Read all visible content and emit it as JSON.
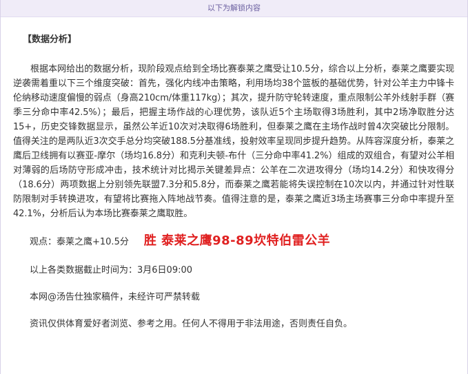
{
  "unlock_bar": {
    "text": "以下为解锁内容"
  },
  "article": {
    "section_title": "【数据分析】",
    "paragraph": "根据本网给出的数据分析，现阶段观点给到全场比赛泰莱之鹰受让10.5分，综合以上分析，泰莱之鹰要实现逆袭需着重以下三个维度突破：首先，强化内线冲击策略，利用场均38个篮板的基础优势，针对公羊主力中锋卡伦纳移动速度偏慢的弱点（身高210cm/体重117kg）；其次，提升防守轮转速度，重点限制公羊外线射手群（赛季三分命中率42.5%）；最后，把握主场作战的心理优势，该队近5个主场取得3场胜利，其中2场净取胜分达15+，历史交锋数据显示，虽然公羊近10次对决取得6场胜利，但泰莱之鹰在主场作战时曾4次突破比分限制。值得关注的是两队近3次交手总分均突破188.5分基准线，投射效率呈现同步提升趋势。从阵容深度分析，泰莱之鹰后卫线拥有以赛亚-摩尔（场均16.8分）和克利夫顿-布什（三分命中率41.2%）组成的双组合，有望对公羊相对薄弱的后场防守形成冲击，技术统计对比揭示关键差异点：公羊在二次进攻得分（场均14.2分）和快攻得分（18.6分）两项数据上分别领先联盟7.3分和5.8分，而泰莱之鹰若能将失误控制在10次以内，并通过针对性联防限制对手转换进攻，有望将比赛拖入阵地战节奏。值得注意的是，泰莱之鹰近3场主场赛事三分命中率提升至42.1%，分析后认为本场比赛泰莱之鹰取胜。",
    "verdict_label": "观点：泰莱之鹰+10.5分",
    "verdict_result": "胜  泰莱之鹰98-89坎特伯雷公羊",
    "data_cutoff": "以上各类数据截止时间为：3月6日09:00",
    "copyright": "本网@汤告仕独家稿件，未经许可严禁转载",
    "disclaimer": "资讯仅供体育爱好者浏览、参考之用。任何人不得用于非法用途，否则责任自负。"
  },
  "colors": {
    "verdict_red": "#e02020",
    "unlock_bar_bg": "#f0ecf8",
    "unlock_bar_text": "#6b5fa0"
  }
}
